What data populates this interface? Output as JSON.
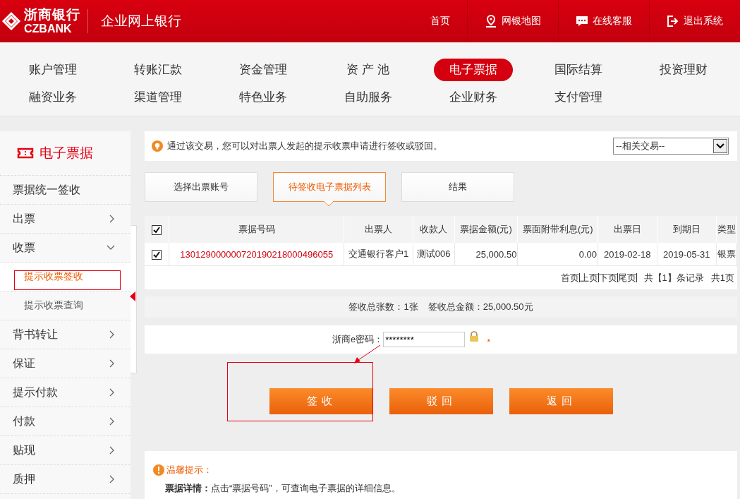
{
  "header": {
    "logo_cn": "浙商银行",
    "logo_en": "CZBANK",
    "title": "企业网上银行",
    "links": [
      {
        "label": "首页",
        "kind": "plain"
      },
      {
        "label": "网银地图",
        "kind": "map"
      },
      {
        "label": "在线客服",
        "kind": "chat"
      },
      {
        "label": "退出系统",
        "kind": "exit"
      }
    ]
  },
  "nav": {
    "items": [
      {
        "label": "账户管理",
        "selected": false
      },
      {
        "label": "转账汇款",
        "selected": false
      },
      {
        "label": "资金管理",
        "selected": false
      },
      {
        "label": "资 产 池",
        "selected": false
      },
      {
        "label": "电子票据",
        "selected": true
      },
      {
        "label": "国际结算",
        "selected": false
      },
      {
        "label": "投资理财",
        "selected": false
      },
      {
        "label": "融资业务",
        "selected": false
      },
      {
        "label": "渠道管理",
        "selected": false
      },
      {
        "label": "特色业务",
        "selected": false
      },
      {
        "label": "自助服务",
        "selected": false
      },
      {
        "label": "企业财务",
        "selected": false
      },
      {
        "label": "支付管理",
        "selected": false
      }
    ]
  },
  "sidebar": {
    "title": "电子票据",
    "items": [
      {
        "label": "票据统一签收",
        "kind": "link"
      },
      {
        "label": "出票",
        "kind": "group",
        "expanded": false
      },
      {
        "label": "收票",
        "kind": "group",
        "expanded": true,
        "children": [
          {
            "label": "提示收票签收",
            "selected": true
          },
          {
            "label": "提示收票查询",
            "selected": false
          }
        ]
      },
      {
        "label": "背书转让",
        "kind": "group",
        "expanded": false
      },
      {
        "label": "保证",
        "kind": "group",
        "expanded": false
      },
      {
        "label": "提示付款",
        "kind": "group",
        "expanded": false
      },
      {
        "label": "付款",
        "kind": "group",
        "expanded": false
      },
      {
        "label": "贴现",
        "kind": "group",
        "expanded": false
      },
      {
        "label": "质押",
        "kind": "group",
        "expanded": false
      }
    ]
  },
  "notice": {
    "text": "通过该交易，您可以对出票人发起的提示收票申请进行签收或驳回。",
    "related_select": "--相关交易--"
  },
  "steps": [
    {
      "label": "选择出票账号",
      "selected": false
    },
    {
      "label": "待签收电子票据列表",
      "selected": true
    },
    {
      "label": "结果",
      "selected": false
    }
  ],
  "table": {
    "header_checked": true,
    "columns": [
      "票据号码",
      "出票人",
      "收款人",
      "票据金额(元)",
      "票面附带利息(元)",
      "出票日",
      "到期日",
      "类型"
    ],
    "rows": [
      {
        "checked": true,
        "cells": [
          "130129000000720190218000496055",
          "交通银行客户1",
          "测试006",
          "25,000.50",
          "0.00",
          "2019-02-18",
          "2019-05-31",
          "银票"
        ]
      }
    ],
    "pager": {
      "links": [
        "首页",
        "上页",
        "下页",
        "尾页"
      ],
      "records": "共【1】条记录",
      "pages": "共1页"
    }
  },
  "summary": {
    "count": "签收总张数：1张",
    "amount": "签收总金额：25,000.50元"
  },
  "password": {
    "label": "浙商e密码：",
    "value": "********",
    "required": "*"
  },
  "buttons": [
    "签收",
    "驳回",
    "返回"
  ],
  "tips": {
    "title": "温馨提示：",
    "text": "**票据详情：**点击“票据号码”，可查询电子票据的详细信息。"
  }
}
